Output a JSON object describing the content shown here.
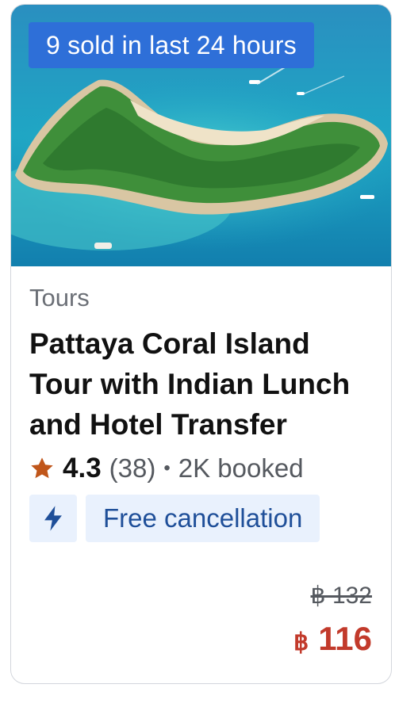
{
  "card": {
    "badge": "9 sold in last 24 hours",
    "category": "Tours",
    "title": "Pattaya Coral Island Tour with Indian Lunch and Hotel Transfer",
    "rating": "4.3",
    "reviews": "(38)",
    "separator": "•",
    "booked": "2K booked",
    "feature_chip": "Free cancellation",
    "original_price": "฿ 132",
    "price_currency": "฿",
    "price_amount": "116"
  },
  "colors": {
    "badge_bg": "#2e6fd8",
    "chip_bg": "#e9f1fd",
    "chip_text": "#1f4f99",
    "price": "#c23a2b",
    "star": "#c0561a"
  },
  "icons": [
    "star-icon",
    "lightning-bolt-icon"
  ]
}
